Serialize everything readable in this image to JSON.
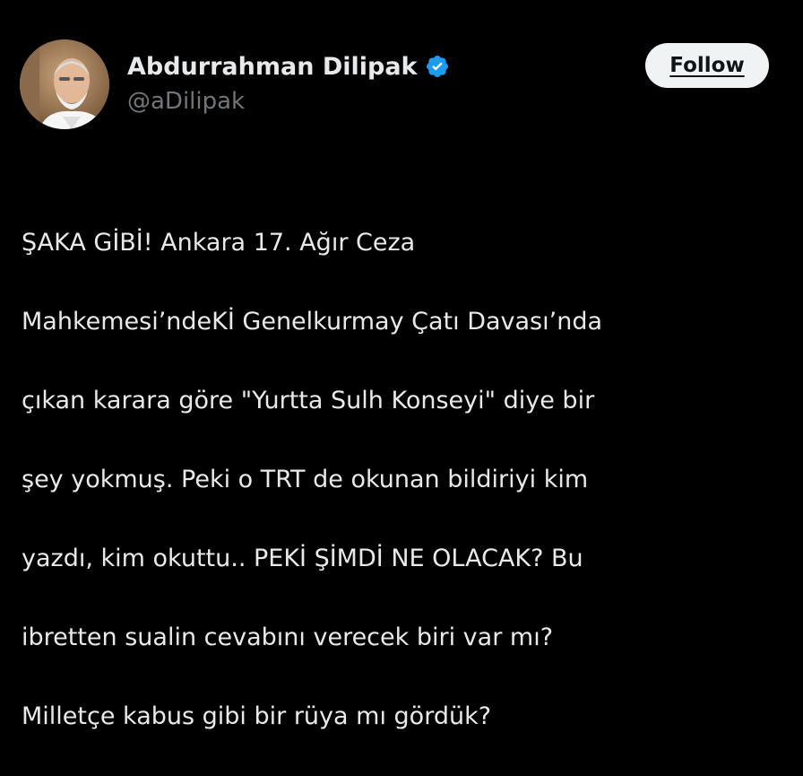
{
  "author": {
    "display_name": "Abdurrahman Dilipak",
    "handle": "@aDilipak",
    "verified_icon": "verified-badge-icon",
    "avatar_icon": "profile-photo-avatar"
  },
  "actions": {
    "follow_label": "Follow"
  },
  "tweet": {
    "lines": [
      "ŞAKA GİBİ! Ankara 17. Ağır Ceza",
      "Mahkemesi’ndeKİ Genelkurmay Çatı Davası’nda",
      "çıkan karara göre \"Yurtta Sulh Konseyi\" diye bir",
      "şey yokmuş. Peki o TRT de okunan bildiriyi kim",
      "yazdı, kim okuttu.. PEKİ ŞİMDİ NE OLACAK? Bu",
      "ibretten sualin cevabını verecek biri var mı?",
      "Milletçe kabus gibi bir rüya mı gördük?"
    ]
  },
  "colors": {
    "background": "#000000",
    "text_primary": "#e7e9ea",
    "text_secondary": "#71767b",
    "verified_blue": "#1d9bf0",
    "follow_bg": "#eff3f4",
    "follow_text": "#0f1419"
  }
}
